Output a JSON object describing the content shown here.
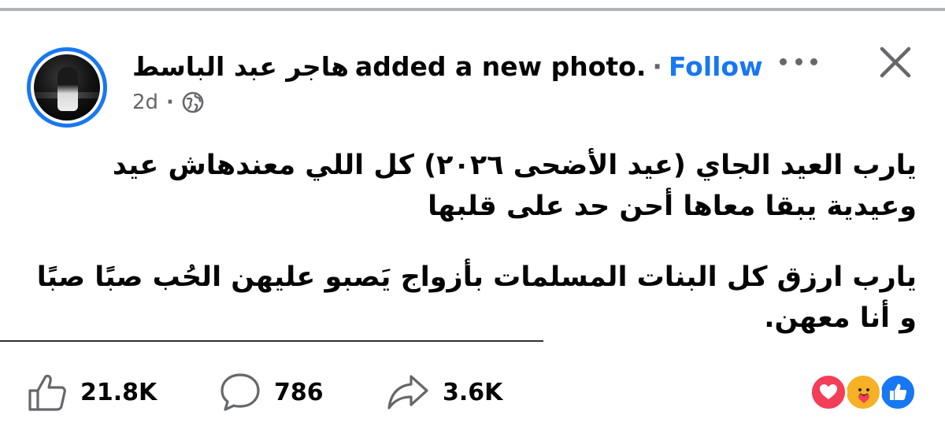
{
  "post": {
    "author": "هاجر عبد الباسط",
    "action_text": "added a new photo.",
    "separator": "·",
    "follow_label": "Follow",
    "time": "2d",
    "paragraph1": "يارب العيد الجاي (عيد الأضحى ٢٠٢٦) كل اللي معندهاش عيد وعيدية يبقا معاها أحن حد على قلبها",
    "paragraph2": "يارب ارزق كل البنات المسلمات بأزواج يَصبو عليهن الحُب صبًا صبًا و أنا معهن."
  },
  "stats": {
    "likes": "21.8K",
    "comments": "786",
    "shares": "3.6K"
  },
  "icons": {
    "avatar": "profile-photo",
    "more": "more-options-icon",
    "close": "close-icon",
    "privacy": "globe-icon",
    "like": "thumbs-up-icon",
    "comment": "comment-bubble-icon",
    "share": "share-arrow-icon",
    "reactions": [
      "love-reaction",
      "care-reaction",
      "like-reaction"
    ]
  },
  "colors": {
    "accent": "#1877f2",
    "muted": "#65676b",
    "love": "#f33e58",
    "care": "#f7b125"
  }
}
